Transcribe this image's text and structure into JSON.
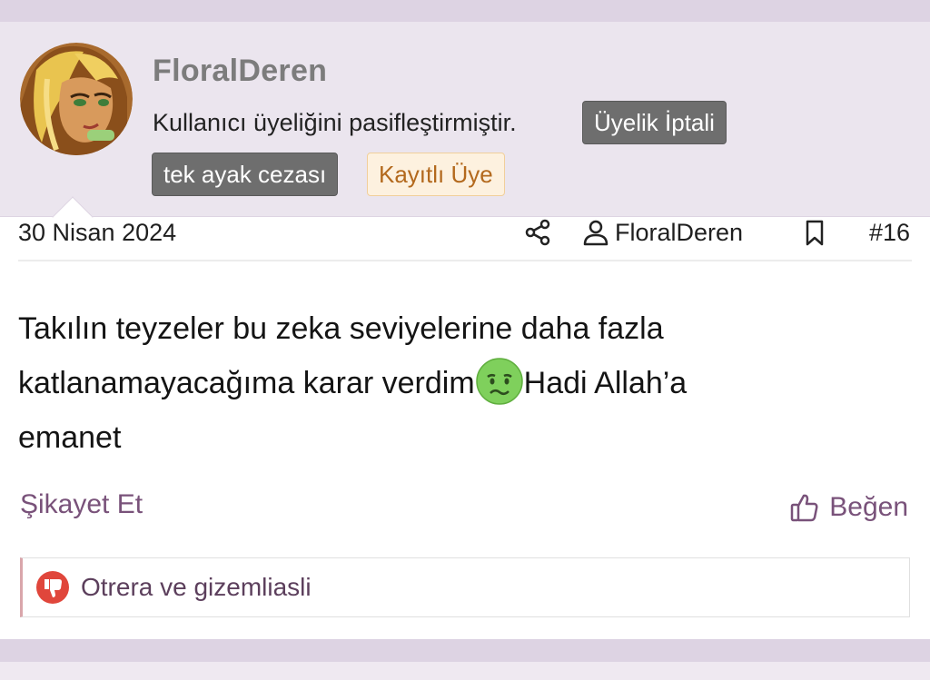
{
  "author": {
    "username": "FloralDeren",
    "status_text": "Kullanıcı üyeliğini pasifleştirmiştir.",
    "badges": {
      "cancel": "Üyelik İptali",
      "penalty": "tek ayak cezası",
      "member": "Kayıtlı Üye"
    },
    "avatar_icon": "cartoon-girl-avatar"
  },
  "meta": {
    "date": "30 Nisan 2024",
    "share_icon": "share-icon",
    "author_label": "FloralDeren",
    "bookmark_icon": "bookmark-icon",
    "post_number": "#16"
  },
  "message": {
    "line1": "Takılın teyzeler bu zeka seviyelerine daha fazla",
    "line2_before": "katlanamayacağıma karar verdim",
    "emoji": "nauseated-face",
    "line2_after": "Hadi Allah’a",
    "line3": "emanet"
  },
  "actions": {
    "report": "Şikayet Et",
    "like": "Beğen"
  },
  "reactions": {
    "icon": "dislike-icon",
    "text": "Otrera ve gizemliasli"
  },
  "colors": {
    "header_bg": "#ebe5ee",
    "page_bg": "#ddd3e3",
    "link": "#79527a",
    "badge_dark": "#6e6e6e",
    "badge_member_bg": "#fdf1df",
    "badge_member_text": "#b3691d",
    "dislike": "#e0463b"
  }
}
